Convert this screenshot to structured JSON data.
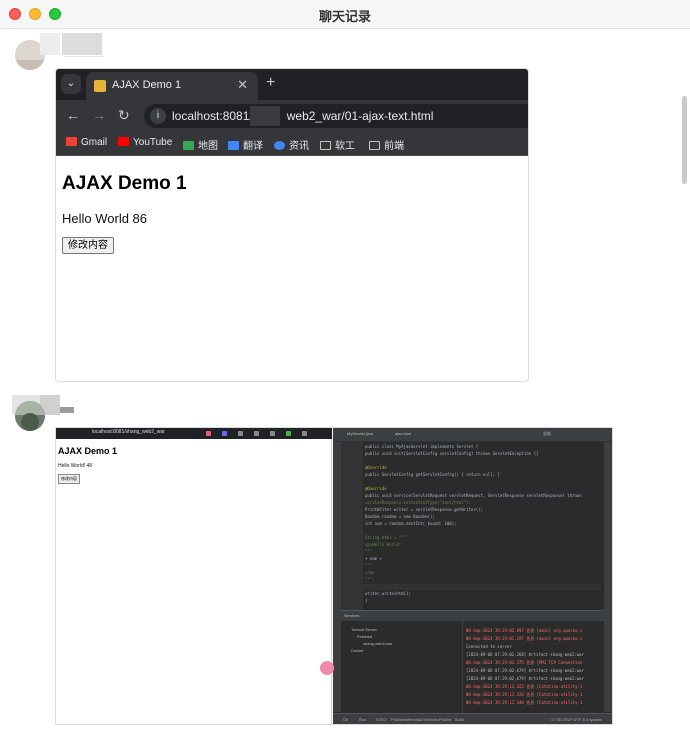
{
  "window": {
    "title": "聊天记录"
  },
  "message1": {
    "screenshot": {
      "tab_title": "AJAX Demo 1",
      "url_prefix": "localhost:8081/",
      "url_suffix": "web2_war/01-ajax-text.html",
      "bookmarks": [
        {
          "label": "Gmail",
          "icon": "gmail-icon",
          "color": "#ea4335"
        },
        {
          "label": "YouTube",
          "icon": "youtube-icon",
          "color": "#ff0000"
        },
        {
          "label": "地图",
          "icon": "maps-icon",
          "color": "#34a853"
        },
        {
          "label": "翻译",
          "icon": "translate-icon",
          "color": "#4285f4"
        },
        {
          "label": "资讯",
          "icon": "news-icon",
          "color": "#4285f4"
        },
        {
          "label": "软工",
          "icon": "folder-icon",
          "color": "#c4c7c5"
        },
        {
          "label": "前端",
          "icon": "folder-icon",
          "color": "#c4c7c5"
        }
      ],
      "page_heading": "AJAX Demo 1",
      "page_text": "Hello World 86",
      "page_button": "修改内容"
    }
  },
  "message2": {
    "screenshot": {
      "browser": {
        "url": "localhost:8081/shang_web2_war",
        "heading": "AJAX Demo 1",
        "text": "Hello World! 48",
        "button": "修改内容"
      },
      "ide": {
        "tabs": [
          "MyServlet.java",
          "ajax.html",
          "总结"
        ],
        "code_lines": [
          "public class MyAjaxServlet implements Servlet {",
          "    public void init(ServletConfig servletConfig) throws ServletException {}",
          "",
          "    @Override",
          "    public ServletConfig getServletConfig() { return null; }",
          "",
          "    @Override",
          "    public void service(ServletRequest servletRequest, ServletResponse servletResponse) throws",
          "        servletResponse.setContentType(\"text/html\");",
          "        PrintWriter writer = servletResponse.getWriter();",
          "        Random random = new Random();",
          "        int num = random.nextInt( bound: 100);",
          "",
          "        String html = \"\"\"",
          "            <p>Hello World!",
          "            \"\"\"",
          "            + num +",
          "            \"\"\"",
          "            </p>",
          "            \"\"\";",
          "",
          "        writer.write(html);",
          "    }"
        ],
        "debug_title": "Services",
        "tree": [
          "Tomcat Server",
          "Finished",
          "shang-web2:war",
          "Docker"
        ],
        "log_lines": [
          {
            "text": "06-Sep-2024 19:29:02.097 信息 [main] org.apache.c",
            "color": "#ff6b68"
          },
          {
            "text": "06-Sep-2024 19:29:02.197 信息 [main] org.apache.c",
            "color": "#ff6b68"
          },
          {
            "text": "Connected to server",
            "color": "#bbbbbb"
          },
          {
            "text": "[2024-09-06 07:29:02,268] Artifact shang-web2:war",
            "color": "#bbbbbb"
          },
          {
            "text": "06-Sep-2024 19:29:02.375 信息 [RMI TCP Connection",
            "color": "#ff6b68"
          },
          {
            "text": "[2024-09-06 07:29:02,679] Artifact shang-web2:war",
            "color": "#bbbbbb"
          },
          {
            "text": "[2024-09-06 07:29:02,679] Artifact shang-web2:war",
            "color": "#bbbbbb"
          },
          {
            "text": "06-Sep-2024 19:29:12.322 信息 [Catalina-utility-1",
            "color": "#ff6b68"
          },
          {
            "text": "06-Sep-2024 19:29:12.326 信息 [Catalina-utility-1",
            "color": "#ff6b68"
          },
          {
            "text": "06-Sep-2024 19:29:12.340 信息 [Catalina-utility-1",
            "color": "#ff6b68"
          }
        ],
        "status": [
          "Git",
          "Run",
          "TODO",
          "Problems",
          "Terminal",
          "Services",
          "Profiler",
          "Build"
        ],
        "status_right": "17:36  CRLF  UTF-8  4 spaces"
      }
    }
  }
}
